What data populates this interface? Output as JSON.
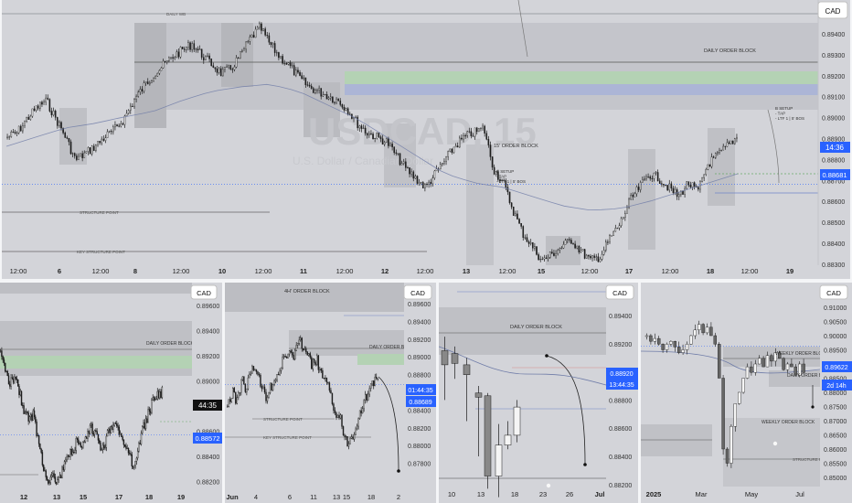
{
  "charts": {
    "main": {
      "currency": "CAD",
      "price_ticks": [
        "0.89400",
        "0.89300",
        "0.89200",
        "0.89100",
        "0.89000",
        "0.88900",
        "0.88800",
        "0.88700",
        "0.88600",
        "0.88500",
        "0.88400",
        "0.88300"
      ],
      "price_values": [
        0.894,
        0.893,
        0.892,
        0.891,
        0.89,
        0.889,
        0.888,
        0.887,
        0.886,
        0.885,
        0.884,
        0.883
      ],
      "time_ticks": [
        "12:00",
        "6",
        "12:00",
        "8",
        "12:00",
        "10",
        "12:00",
        "11",
        "12:00",
        "12",
        "12:00",
        "13",
        "12:00",
        "15",
        "12:00",
        "17",
        "12:00",
        "18",
        "12:00",
        "19"
      ],
      "annotations": {
        "daily_ob": "DAILY ORDER BLOCK",
        "m15_ob": "15' ORDER BLOCK",
        "structure_point": "STRUCTURE POINT",
        "key_structure_point": "KEY STRUCTURE POINT",
        "setup1": [
          "B SETUP",
          "- TAP",
          "- LTF 1 | 5' BOS"
        ],
        "setup2": [
          "B SETUP",
          "- TAP",
          "- LTF 1 | 5' BOS"
        ],
        "daily_top": "DAILY WB"
      },
      "price_labels": {
        "countdown": "14:36",
        "last_price": "0.88681"
      },
      "price_line_value": 0.88681,
      "watermark": "USDCAD, 15",
      "watermark_sub": "U.S. Dollar / Canadian Dollar"
    },
    "bl": {
      "currency": "CAD",
      "price_ticks": [
        "0.89600",
        "0.89400",
        "0.89200",
        "0.89000",
        "0.88800",
        "0.88600",
        "0.88400",
        "0.88200"
      ],
      "price_values": [
        0.896,
        0.894,
        0.892,
        0.89,
        0.888,
        0.886,
        0.884,
        0.882
      ],
      "time_ticks": [
        "12",
        "13",
        "15",
        "17",
        "18",
        "19"
      ],
      "annotations": {
        "daily_ob": "DAILY ORDER BLOCK"
      },
      "price_labels": {
        "countdown": "44:35",
        "last_price": "0.88572"
      }
    },
    "bm": {
      "currency": "CAD",
      "price_ticks": [
        "0.89600",
        "0.89400",
        "0.89200",
        "0.89000",
        "0.88800",
        "0.88600",
        "0.88400",
        "0.88200",
        "0.88000",
        "0.87800"
      ],
      "price_values": [
        0.896,
        0.894,
        0.892,
        0.89,
        0.888,
        0.886,
        0.884,
        0.882,
        0.88,
        0.878
      ],
      "time_ticks": [
        "Jun",
        "4",
        "6",
        "11",
        "13",
        "15",
        "18",
        "2"
      ],
      "annotations": {
        "h4_ob": "4H' ORDER BLOCK",
        "daily_ob": "DAILY ORDER BLOCK",
        "structure_point": "STRUCTURE POINT",
        "key_structure_point": "KEY STRUCTURE POINT"
      },
      "price_labels": {
        "countdown": "01:44:35",
        "last_price": "0.88689"
      }
    },
    "bc": {
      "currency": "CAD",
      "price_ticks": [
        "0.89400",
        "0.89200",
        "0.89000",
        "0.88800",
        "0.88600",
        "0.88400",
        "0.88200",
        "0.88000"
      ],
      "price_values": [
        0.894,
        0.892,
        0.89,
        0.888,
        0.886,
        0.884,
        0.882,
        0.88
      ],
      "time_ticks": [
        "10",
        "13",
        "18",
        "23",
        "26",
        "Jul"
      ],
      "annotations": {
        "daily_ob": "DAILY ORDER BLOCK"
      },
      "price_labels": {
        "last_price": "0.88920",
        "countdown": "13:44:35"
      }
    },
    "br": {
      "currency": "CAD",
      "price_ticks": [
        "0.91000",
        "0.90500",
        "0.90000",
        "0.89500",
        "0.89000",
        "0.88500",
        "0.88000",
        "0.87500",
        "0.87000",
        "0.86500",
        "0.86000",
        "0.85500",
        "0.85000"
      ],
      "price_values": [
        0.91,
        0.905,
        0.9,
        0.895,
        0.89,
        0.885,
        0.88,
        0.875,
        0.87,
        0.865,
        0.86,
        0.855,
        0.85
      ],
      "time_ticks": [
        "2025",
        "Mar",
        "May",
        "Jul"
      ],
      "annotations": {
        "weekly_ob": "WEEKLY ORDER BLOCK",
        "daily_ob": "DAILY ORDER BLOCK",
        "weekly_ob2": "WEEKLY ORDER BLOCK",
        "structure_point": "STRUCTURE PO"
      },
      "price_labels": {
        "last_price": "0.89622",
        "countdown": "2d 14h"
      }
    }
  },
  "colors": {
    "bg": "#d3d4d9",
    "candle": "#1c1c1c",
    "highlight": "#2962ff",
    "ob_zone": "#b9babf",
    "green_zone": "#b9d7b8",
    "blue_zone": "#a9b4db",
    "ma": "#6f7ca8"
  }
}
